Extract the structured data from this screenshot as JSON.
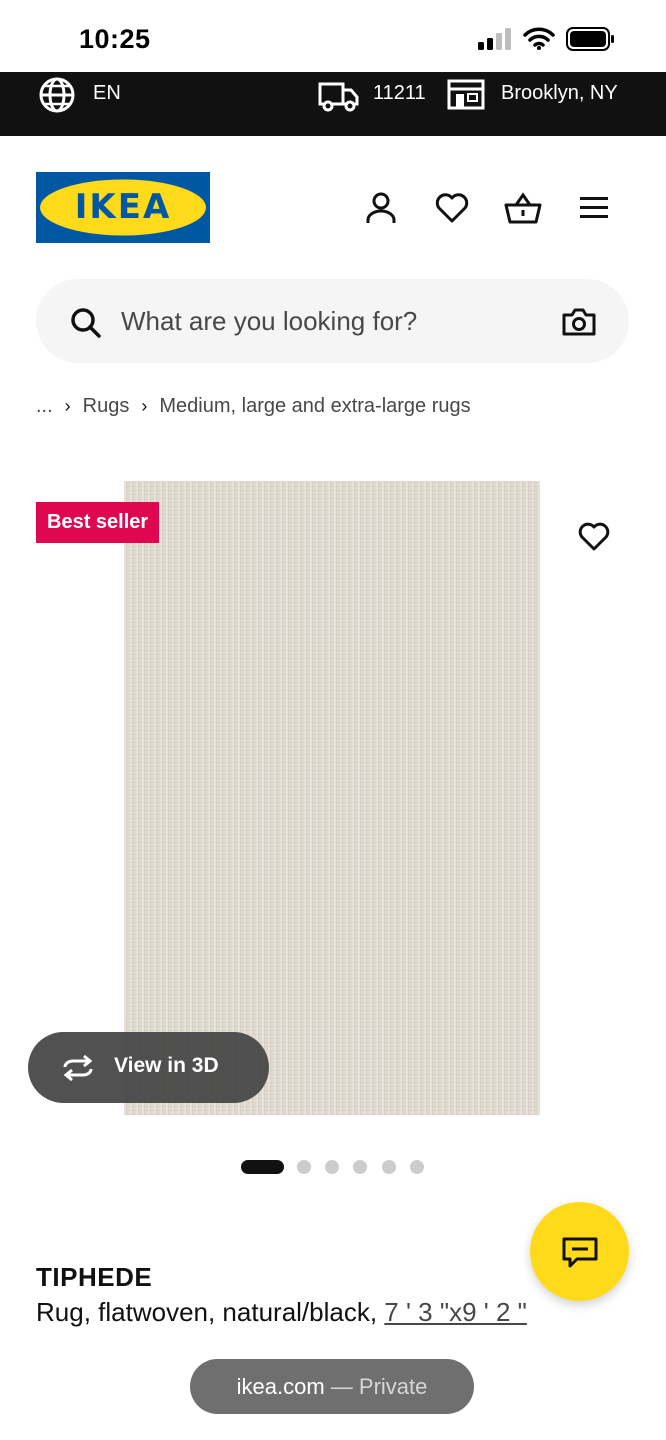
{
  "status_bar": {
    "time": "10:25"
  },
  "top_bar": {
    "language": "EN",
    "zip": "11211",
    "store": "Brooklyn, NY"
  },
  "header": {
    "logo_text": "IKEA"
  },
  "search": {
    "placeholder": "What are you looking for?"
  },
  "breadcrumb": {
    "ellipsis": "...",
    "items": [
      "Rugs",
      "Medium, large and extra-large rugs"
    ]
  },
  "product_image": {
    "badge": "Best seller",
    "view_3d_label": "View in 3D",
    "carousel_count": 6,
    "carousel_active_index": 0
  },
  "product": {
    "name": "TIPHEDE",
    "description": "Rug, flatwoven, natural/black, ",
    "size": "7 ' 3 \"x9 ' 2 \""
  },
  "browser": {
    "url": "ikea.com",
    "mode": " — Private"
  },
  "colors": {
    "brand_blue": "#0058a3",
    "brand_yellow": "#ffda1a",
    "badge_pink": "#e00751"
  }
}
